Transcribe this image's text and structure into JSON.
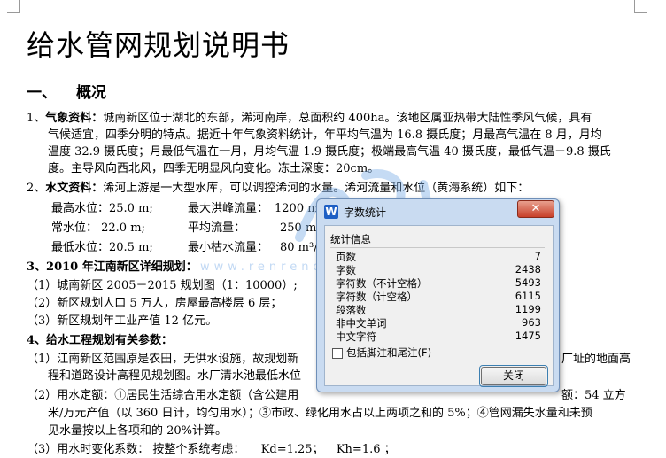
{
  "document": {
    "title": "给水管网规划说明书",
    "h1_number": "一、",
    "h1_text": "概况",
    "s1_num": "1、",
    "s1_head": "气象资料：",
    "s1_l1": "城南新区位于湖北的东部，浠河南岸，总面积约 400ha。该地区属亚热带大陆性季风气候，具有",
    "s1_l2": "气候适宜，四季分明的特点。据近十年气象资料统计，年平均气温为 16.8 摄氏度；月最高气温在 8 月，月均",
    "s1_l3": "温度 32.9 摄氏度；月最低气温在一月，月均气温 1.9 摄氏度；极端最高气温 40 摄氏度，最低气温－9.8 摄氏",
    "s1_l4": "度。主导风向西北风，四季无明显风向变化。冻土深度：20cm。",
    "s2_num": "2、",
    "s2_head": "水文资料：",
    "s2_l1": "浠河上游是一大型水库，可以调控浠河的水量。浠河流量和水位（黄海系统）如下：",
    "h_label1": "最高水位：25.0 m;",
    "h_label2": "最大洪峰流量：",
    "h_val2": "1200 m³",
    "n_label1": "常水位：   22.0 m;",
    "n_label2": "平均流量：",
    "n_val2": "250 m³",
    "l_label1": "最低水位：20.5 m;",
    "l_label2": "最小枯水流量：",
    "l_val2": "80 m³/",
    "s3_head": "3、2010 年江南新区详细规划：",
    "s3_l1": "（1）城南新区 2005－2015 规划图（1：10000）;",
    "s3_l2": "（2）新区规划人口 5 万人，房屋最高楼层 6 层；",
    "s3_l3": "（3）新区规划年工业产值 12 亿元。",
    "s4_head": "4、给水工程规划有关参数：",
    "s4_l1a": "（1）江南新区范围原是农田，无供水设施，故规划新",
    "s4_l1b": "厂址的地面高",
    "s4_l2": "程和道路设计高程见规划图。水厂清水池最低水位",
    "s4_l3a": "（2）用水定额：①居民生活综合用水定额（含公建用",
    "s4_l3b": "额：54 立方",
    "s4_l4": "米/万元产值（以 360 日计，均匀用水）；③市政、绿化用水占以上两项之和的 5%；④管网漏失水量和未预",
    "s4_l5": "见水量按以上各项和的 20%计算。",
    "s4_l6a": "（3）用水时变化系数：  按整个系统考虑：",
    "kd": "Kd=1.25；",
    "kh": "Kh=1.6 ；"
  },
  "watermark": {
    "url": "www.renrendoc.com",
    "color": "#7fb0e6"
  },
  "dialog": {
    "title": "字数统计",
    "app_icon": "W",
    "close_x": "✕",
    "group_label": "统计信息",
    "stats": [
      {
        "label": "页数",
        "value": "7"
      },
      {
        "label": "字数",
        "value": "2438"
      },
      {
        "label": "字符数（不计空格）",
        "value": "5493"
      },
      {
        "label": "字符数（计空格）",
        "value": "6115"
      },
      {
        "label": "段落数",
        "value": "1199"
      },
      {
        "label": "非中文单词",
        "value": "963"
      },
      {
        "label": "中文字符",
        "value": "1475"
      }
    ],
    "checkbox_label": "包括脚注和尾注(F)",
    "checkbox_checked": false,
    "close_button": "关闭"
  }
}
